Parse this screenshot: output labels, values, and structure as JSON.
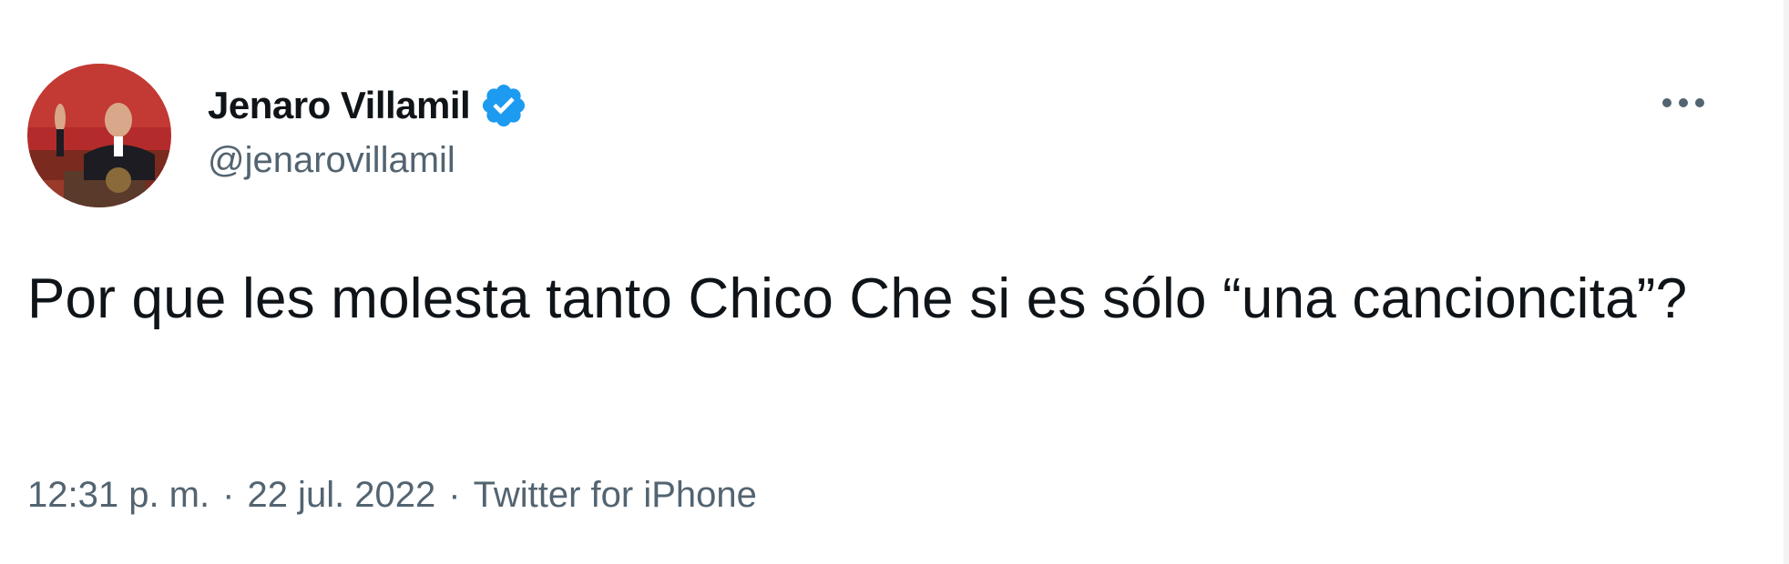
{
  "author": {
    "display_name": "Jenaro Villamil",
    "handle": "@jenarovillamil",
    "verified": true,
    "avatar_icon": "profile-photo"
  },
  "tweet": {
    "text": "Por que les molesta tanto Chico Che si es sólo “una cancioncita”?"
  },
  "meta": {
    "time": "12:31 p. m.",
    "separator": "·",
    "date": "22 jul. 2022",
    "source": "Twitter for iPhone"
  },
  "actions": {
    "more_icon": "more-options-icon"
  },
  "colors": {
    "text": "#0f1419",
    "secondary": "#536471",
    "verified": "#1d9bf0"
  }
}
